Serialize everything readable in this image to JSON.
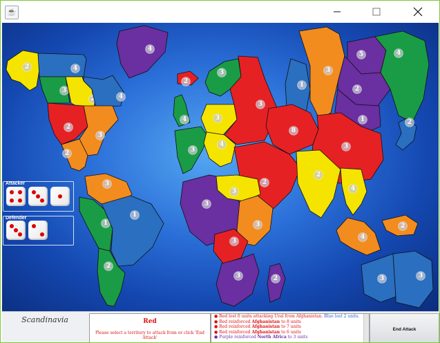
{
  "window": {
    "minimize_icon": "minimize-icon",
    "maximize_icon": "maximize-icon",
    "close_icon": "close-icon",
    "app_icon": "java-icon"
  },
  "colors": {
    "red": "#e62124",
    "blue": "#2a6fc0",
    "green": "#1a9c46",
    "purple": "#6a2fa0",
    "orange": "#f28c1e",
    "yellow": "#f5e400"
  },
  "territories": [
    {
      "id": "alaska",
      "owner": "yellow",
      "armies": "2"
    },
    {
      "id": "northwest-territory",
      "owner": "blue",
      "armies": "4"
    },
    {
      "id": "greenland",
      "owner": "purple",
      "armies": "4"
    },
    {
      "id": "alberta",
      "owner": "green",
      "armies": "3"
    },
    {
      "id": "ontario",
      "owner": "yellow",
      "armies": "2"
    },
    {
      "id": "quebec",
      "owner": "blue",
      "armies": "4"
    },
    {
      "id": "western-us",
      "owner": "red",
      "armies": "2"
    },
    {
      "id": "eastern-us",
      "owner": "orange",
      "armies": "3"
    },
    {
      "id": "central-america",
      "owner": "orange",
      "armies": "2"
    },
    {
      "id": "iceland",
      "owner": "red",
      "armies": "2"
    },
    {
      "id": "scandinavia",
      "owner": "green",
      "armies": "3"
    },
    {
      "id": "great-britain",
      "owner": "green",
      "armies": "4"
    },
    {
      "id": "northern-europe",
      "owner": "yellow",
      "armies": "3"
    },
    {
      "id": "western-europe",
      "owner": "green",
      "armies": "3"
    },
    {
      "id": "southern-europe",
      "owner": "yellow",
      "armies": "4"
    },
    {
      "id": "ukraine",
      "owner": "red",
      "armies": "3"
    },
    {
      "id": "ural",
      "owner": "blue",
      "armies": "1"
    },
    {
      "id": "siberia",
      "owner": "orange",
      "armies": "3"
    },
    {
      "id": "yakutsk",
      "owner": "purple",
      "armies": "5"
    },
    {
      "id": "kamchatka",
      "owner": "green",
      "armies": "4"
    },
    {
      "id": "irkutsk",
      "owner": "purple",
      "armies": "2"
    },
    {
      "id": "mongolia",
      "owner": "purple",
      "armies": "1"
    },
    {
      "id": "japan",
      "owner": "blue",
      "armies": "2"
    },
    {
      "id": "afghanistan",
      "owner": "red",
      "armies": "8"
    },
    {
      "id": "china",
      "owner": "red",
      "armies": "3"
    },
    {
      "id": "middle-east",
      "owner": "red",
      "armies": "2"
    },
    {
      "id": "india",
      "owner": "yellow",
      "armies": "2"
    },
    {
      "id": "siam",
      "owner": "yellow",
      "armies": "4"
    },
    {
      "id": "venezuela",
      "owner": "orange",
      "armies": "3"
    },
    {
      "id": "peru",
      "owner": "green",
      "armies": "1"
    },
    {
      "id": "brazil",
      "owner": "blue",
      "armies": "1"
    },
    {
      "id": "argentina",
      "owner": "green",
      "armies": "2"
    },
    {
      "id": "north-africa",
      "owner": "purple",
      "armies": "3"
    },
    {
      "id": "egypt",
      "owner": "yellow",
      "armies": "3"
    },
    {
      "id": "east-africa",
      "owner": "orange",
      "armies": "3"
    },
    {
      "id": "congo",
      "owner": "red",
      "armies": "3"
    },
    {
      "id": "south-africa",
      "owner": "purple",
      "armies": "3"
    },
    {
      "id": "madagascar",
      "owner": "purple",
      "armies": "2"
    },
    {
      "id": "indonesia",
      "owner": "orange",
      "armies": "4"
    },
    {
      "id": "new-guinea",
      "owner": "orange",
      "armies": "2"
    },
    {
      "id": "western-australia",
      "owner": "blue",
      "armies": "3"
    },
    {
      "id": "eastern-australia",
      "owner": "blue",
      "armies": "3"
    }
  ],
  "dice": {
    "attacker_label": "Attacker",
    "defender_label": "Defender",
    "attacker": [
      4,
      3,
      1
    ],
    "defender": [
      3,
      2
    ]
  },
  "status": {
    "territory": "Scandinavia",
    "player": "Red",
    "message": "Please select a territory to attack from or click 'End Attack'"
  },
  "log": [
    {
      "segments": [
        {
          "t": "Red lost 0 units attacking Ural from Afghanistan. ",
          "c": "red"
        },
        {
          "t": "Blue lost 2 units.",
          "c": "blue"
        }
      ]
    },
    {
      "segments": [
        {
          "t": "Red reinforced ",
          "c": "red"
        },
        {
          "t": "Afghanistan",
          "c": "red",
          "b": true
        },
        {
          "t": " to 8 units",
          "c": "red"
        }
      ]
    },
    {
      "segments": [
        {
          "t": "Red reinforced ",
          "c": "red"
        },
        {
          "t": "Afghanistan",
          "c": "red",
          "b": true
        },
        {
          "t": " to 7 units",
          "c": "red"
        }
      ]
    },
    {
      "segments": [
        {
          "t": "Red reinforced ",
          "c": "red"
        },
        {
          "t": "Afghanistan",
          "c": "red",
          "b": true
        },
        {
          "t": " to 6 units",
          "c": "red"
        }
      ]
    },
    {
      "segments": [
        {
          "t": "Purple reinforced ",
          "c": "purple"
        },
        {
          "t": "North Africa",
          "c": "purple",
          "b": true
        },
        {
          "t": " to 3 units",
          "c": "purple"
        }
      ]
    }
  ],
  "buttons": {
    "end_attack": "End Attack"
  }
}
